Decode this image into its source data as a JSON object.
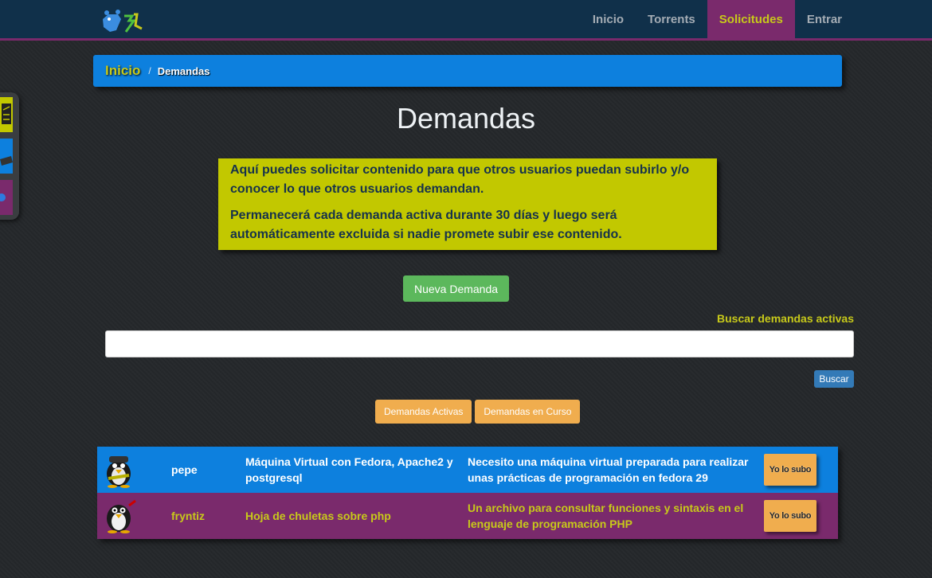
{
  "nav": {
    "items": [
      {
        "label": "Inicio",
        "active": false
      },
      {
        "label": "Torrents",
        "active": false
      },
      {
        "label": "Solicitudes",
        "active": true
      },
      {
        "label": "Entrar",
        "active": false
      }
    ]
  },
  "breadcrumb": {
    "home": "Inicio",
    "separator": "/",
    "current": "Demandas"
  },
  "page": {
    "title": "Demandas"
  },
  "info": {
    "paragraph1": "Aquí puedes solicitar contenido para que otros usuarios puedan subirlo y/o conocer lo que otros usuarios demandan.",
    "paragraph2": "Permanecerá cada demanda activa durante 30 días y luego será automáticamente excluida si nadie promete subir ese contenido."
  },
  "actions": {
    "new_demand": "Nueva Demanda"
  },
  "search": {
    "label": "Buscar demandas activas",
    "value": "",
    "placeholder": "",
    "button": "Buscar"
  },
  "tabs": {
    "active": "Demandas Activas",
    "in_progress": "Demandas en Curso"
  },
  "demands": [
    {
      "user": "pepe",
      "title": "Máquina Virtual con Fedora, Apache2 y postgresql",
      "description": "Necesito una máquina virtual preparada para realizar unas prácticas de programación en fedora 29",
      "button": "Yo lo subo"
    },
    {
      "user": "fryntiz",
      "title": "Hoja de chuletas sobre php",
      "description": "Un archivo para consultar funciones y sintaxis en el lenguaje de programación PHP",
      "button": "Yo lo subo"
    }
  ],
  "colors": {
    "navbar": "#10304a",
    "accent_purple": "#7a2a6c",
    "accent_yellow": "#c7c91a",
    "breadcrumb_blue": "#0d80de",
    "info_box": "#c2c800",
    "success": "#5cb85c",
    "warning": "#f0ad4e",
    "primary": "#337ab7"
  }
}
